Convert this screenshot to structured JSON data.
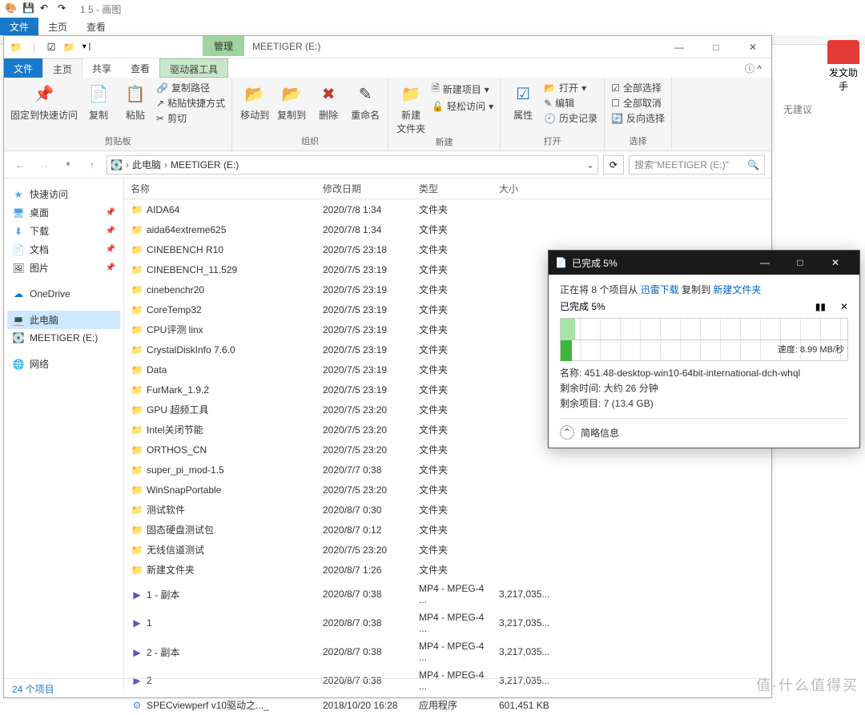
{
  "outer": {
    "tabs": {
      "file": "文件",
      "home": "主页",
      "view": "查看"
    },
    "title": "1 5 - 画图"
  },
  "explorer": {
    "qa_manage": "管理",
    "title": "MEETIGER (E:)",
    "win": {
      "min": "—",
      "max": "□",
      "close": "✕"
    },
    "ribbon_tabs": {
      "file": "文件",
      "home": "主页",
      "share": "共享",
      "view": "查看",
      "drive": "驱动器工具"
    },
    "ribbon": {
      "clipboard": {
        "pin": "固定到快速访问",
        "copy": "复制",
        "paste": "粘贴",
        "path": "复制路径",
        "shortcut": "粘贴快捷方式",
        "cut": "剪切",
        "label": "剪贴板"
      },
      "organize": {
        "moveto": "移动到",
        "copyto": "复制到",
        "delete": "删除",
        "rename": "重命名",
        "label": "组织"
      },
      "new": {
        "folder": "新建\n文件夹",
        "item": "新建项目",
        "easy": "轻松访问",
        "label": "新建"
      },
      "open": {
        "props": "属性",
        "open": "打开",
        "edit": "编辑",
        "history": "历史记录",
        "label": "打开"
      },
      "select": {
        "all": "全部选择",
        "none": "全部取消",
        "invert": "反向选择",
        "label": "选择"
      }
    },
    "breadcrumb": {
      "pc": "此电脑",
      "drive": "MEETIGER (E:)"
    },
    "search_placeholder": "搜索\"MEETIGER (E:)\"",
    "columns": {
      "name": "名称",
      "date": "修改日期",
      "type": "类型",
      "size": "大小"
    },
    "sidebar": {
      "quick": "快速访问",
      "desktop": "桌面",
      "downloads": "下载",
      "documents": "文档",
      "pictures": "图片",
      "onedrive": "OneDrive",
      "thispc": "此电脑",
      "drive": "MEETIGER (E:)",
      "network": "网络"
    },
    "files": [
      {
        "n": "AIDA64",
        "d": "2020/7/8 1:34",
        "t": "文件夹",
        "s": "",
        "i": "f"
      },
      {
        "n": "aida64extreme625",
        "d": "2020/7/8 1:34",
        "t": "文件夹",
        "s": "",
        "i": "f"
      },
      {
        "n": "CINEBENCH R10",
        "d": "2020/7/5 23:18",
        "t": "文件夹",
        "s": "",
        "i": "f"
      },
      {
        "n": "CINEBENCH_11.529",
        "d": "2020/7/5 23:19",
        "t": "文件夹",
        "s": "",
        "i": "f"
      },
      {
        "n": "cinebenchr20",
        "d": "2020/7/5 23:19",
        "t": "文件夹",
        "s": "",
        "i": "f"
      },
      {
        "n": "CoreTemp32",
        "d": "2020/7/5 23:19",
        "t": "文件夹",
        "s": "",
        "i": "f"
      },
      {
        "n": "CPU评测 linx",
        "d": "2020/7/5 23:19",
        "t": "文件夹",
        "s": "",
        "i": "f"
      },
      {
        "n": "CrystalDiskInfo 7.6.0",
        "d": "2020/7/5 23:19",
        "t": "文件夹",
        "s": "",
        "i": "f"
      },
      {
        "n": "Data",
        "d": "2020/7/5 23:19",
        "t": "文件夹",
        "s": "",
        "i": "f"
      },
      {
        "n": "FurMark_1.9.2",
        "d": "2020/7/5 23:19",
        "t": "文件夹",
        "s": "",
        "i": "f"
      },
      {
        "n": "GPU 超频工具",
        "d": "2020/7/5 23:20",
        "t": "文件夹",
        "s": "",
        "i": "f"
      },
      {
        "n": "Intel关闭节能",
        "d": "2020/7/5 23:20",
        "t": "文件夹",
        "s": "",
        "i": "f"
      },
      {
        "n": "ORTHOS_CN",
        "d": "2020/7/5 23:20",
        "t": "文件夹",
        "s": "",
        "i": "f"
      },
      {
        "n": "super_pi_mod-1.5",
        "d": "2020/7/7 0:38",
        "t": "文件夹",
        "s": "",
        "i": "f"
      },
      {
        "n": "WinSnapPortable",
        "d": "2020/7/5 23:20",
        "t": "文件夹",
        "s": "",
        "i": "f"
      },
      {
        "n": "测试软件",
        "d": "2020/8/7 0:30",
        "t": "文件夹",
        "s": "",
        "i": "f"
      },
      {
        "n": "固态硬盘测试包",
        "d": "2020/8/7 0:12",
        "t": "文件夹",
        "s": "",
        "i": "f"
      },
      {
        "n": "无线信道测试",
        "d": "2020/7/5 23:20",
        "t": "文件夹",
        "s": "",
        "i": "f"
      },
      {
        "n": "新建文件夹",
        "d": "2020/8/7 1:26",
        "t": "文件夹",
        "s": "",
        "i": "f"
      },
      {
        "n": "1 - 副本",
        "d": "2020/8/7 0:38",
        "t": "MP4 - MPEG-4 ...",
        "s": "3,217,035...",
        "i": "m"
      },
      {
        "n": "1",
        "d": "2020/8/7 0:38",
        "t": "MP4 - MPEG-4 ...",
        "s": "3,217,035...",
        "i": "m"
      },
      {
        "n": "2 - 副本",
        "d": "2020/8/7 0:38",
        "t": "MP4 - MPEG-4 ...",
        "s": "3,217,035...",
        "i": "m"
      },
      {
        "n": "2",
        "d": "2020/8/7 0:38",
        "t": "MP4 - MPEG-4 ...",
        "s": "3,217,035...",
        "i": "m"
      },
      {
        "n": "SPECviewperf v10驱动之..._",
        "d": "2018/10/20 16:28",
        "t": "应用程序",
        "s": "601,451 KB",
        "i": "e"
      }
    ],
    "status": "24 个项目"
  },
  "dialog": {
    "title": "已完成 5%",
    "line1_a": "正在将 8 个项目从 ",
    "line1_b": "迅雷下载",
    "line1_c": " 复制到 ",
    "line1_d": "新建文件夹",
    "pct": "已完成 5%",
    "pause": "▮▮",
    "cancel": "✕",
    "speed": "速度: 8.99 MB/秒",
    "name_l": "名称: ",
    "name_v": "451.48-desktop-win10-64bit-international-dch-whql",
    "time_l": "剩余时间: ",
    "time_v": "大约 26 分钟",
    "items_l": "剩余项目: ",
    "items_v": "7 (13.4 GB)",
    "more": "简略信息"
  },
  "helper": {
    "label": "发文助手"
  },
  "no_suggest": "无建议",
  "watermark": "值·什么值得买"
}
